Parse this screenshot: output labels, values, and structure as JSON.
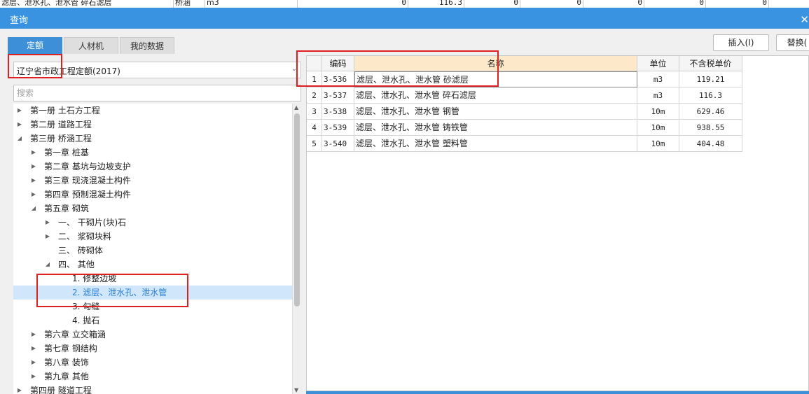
{
  "background_row": {
    "name": "滤层、泄水孔、泄水管 碎石滤层",
    "category": "桥涵",
    "unit": "m3",
    "v1": "0",
    "v2": "116.3",
    "v3": "0",
    "v4": "0",
    "v5": "0",
    "v6": "0",
    "v7": "0"
  },
  "dialog": {
    "title": "查询",
    "close_glyph": "✕"
  },
  "tabs": [
    {
      "label": "定额"
    },
    {
      "label": "人材机"
    },
    {
      "label": "我的数据"
    }
  ],
  "buttons": {
    "insert": "插入(I)",
    "replace": "替换("
  },
  "quota_library": {
    "selected": "辽宁省市政工程定额(2017)"
  },
  "search": {
    "placeholder": "搜索"
  },
  "tree": [
    {
      "label": "第一册 土石方工程",
      "twisty": "▶"
    },
    {
      "label": "第二册 道路工程",
      "twisty": "▶"
    },
    {
      "label": "第三册 桥涵工程",
      "twisty": "◢"
    },
    {
      "label": "第一章 桩基",
      "twisty": "▶"
    },
    {
      "label": "第二章 基坑与边坡支护",
      "twisty": "▶"
    },
    {
      "label": "第三章 现浇混凝土构件",
      "twisty": "▶"
    },
    {
      "label": "第四章 预制混凝土构件",
      "twisty": "▶"
    },
    {
      "label": "第五章 砌筑",
      "twisty": "◢"
    },
    {
      "label": "一、 干砌片(块)石",
      "twisty": "▶"
    },
    {
      "label": "二、 浆砌块料",
      "twisty": "▶"
    },
    {
      "label": "三、 砖砌体",
      "twisty": ""
    },
    {
      "label": "四、 其他",
      "twisty": "◢"
    },
    {
      "label": "1. 修整边坡",
      "twisty": ""
    },
    {
      "label": "2. 滤层、泄水孔、泄水管",
      "twisty": ""
    },
    {
      "label": "3. 勾缝",
      "twisty": ""
    },
    {
      "label": "4. 抛石",
      "twisty": ""
    },
    {
      "label": "第六章 立交箱涵",
      "twisty": "▶"
    },
    {
      "label": "第七章 钢结构",
      "twisty": "▶"
    },
    {
      "label": "第八章 装饰",
      "twisty": "▶"
    },
    {
      "label": "第九章 其他",
      "twisty": "▶"
    },
    {
      "label": "第四册 隧道工程",
      "twisty": "▶"
    }
  ],
  "grid": {
    "headers": {
      "code": "编码",
      "name": "名称",
      "unit": "单位",
      "price": "不含税单价"
    },
    "rows": [
      {
        "no": "1",
        "code": "3-536",
        "name": "滤层、泄水孔、泄水管 砂滤层",
        "unit": "m3",
        "price": "119.21"
      },
      {
        "no": "2",
        "code": "3-537",
        "name": "滤层、泄水孔、泄水管 碎石滤层",
        "unit": "m3",
        "price": "116.3"
      },
      {
        "no": "3",
        "code": "3-538",
        "name": "滤层、泄水孔、泄水管 钢管",
        "unit": "10m",
        "price": "629.46"
      },
      {
        "no": "4",
        "code": "3-539",
        "name": "滤层、泄水孔、泄水管 铸铁管",
        "unit": "10m",
        "price": "938.55"
      },
      {
        "no": "5",
        "code": "3-540",
        "name": "滤层、泄水孔、泄水管 塑料管",
        "unit": "10m",
        "price": "404.48"
      }
    ]
  },
  "colors": {
    "accent": "#3a93e0",
    "selection": "#cfe6fb",
    "annotation": "#e02020",
    "header_highlight": "#fde8c9"
  }
}
